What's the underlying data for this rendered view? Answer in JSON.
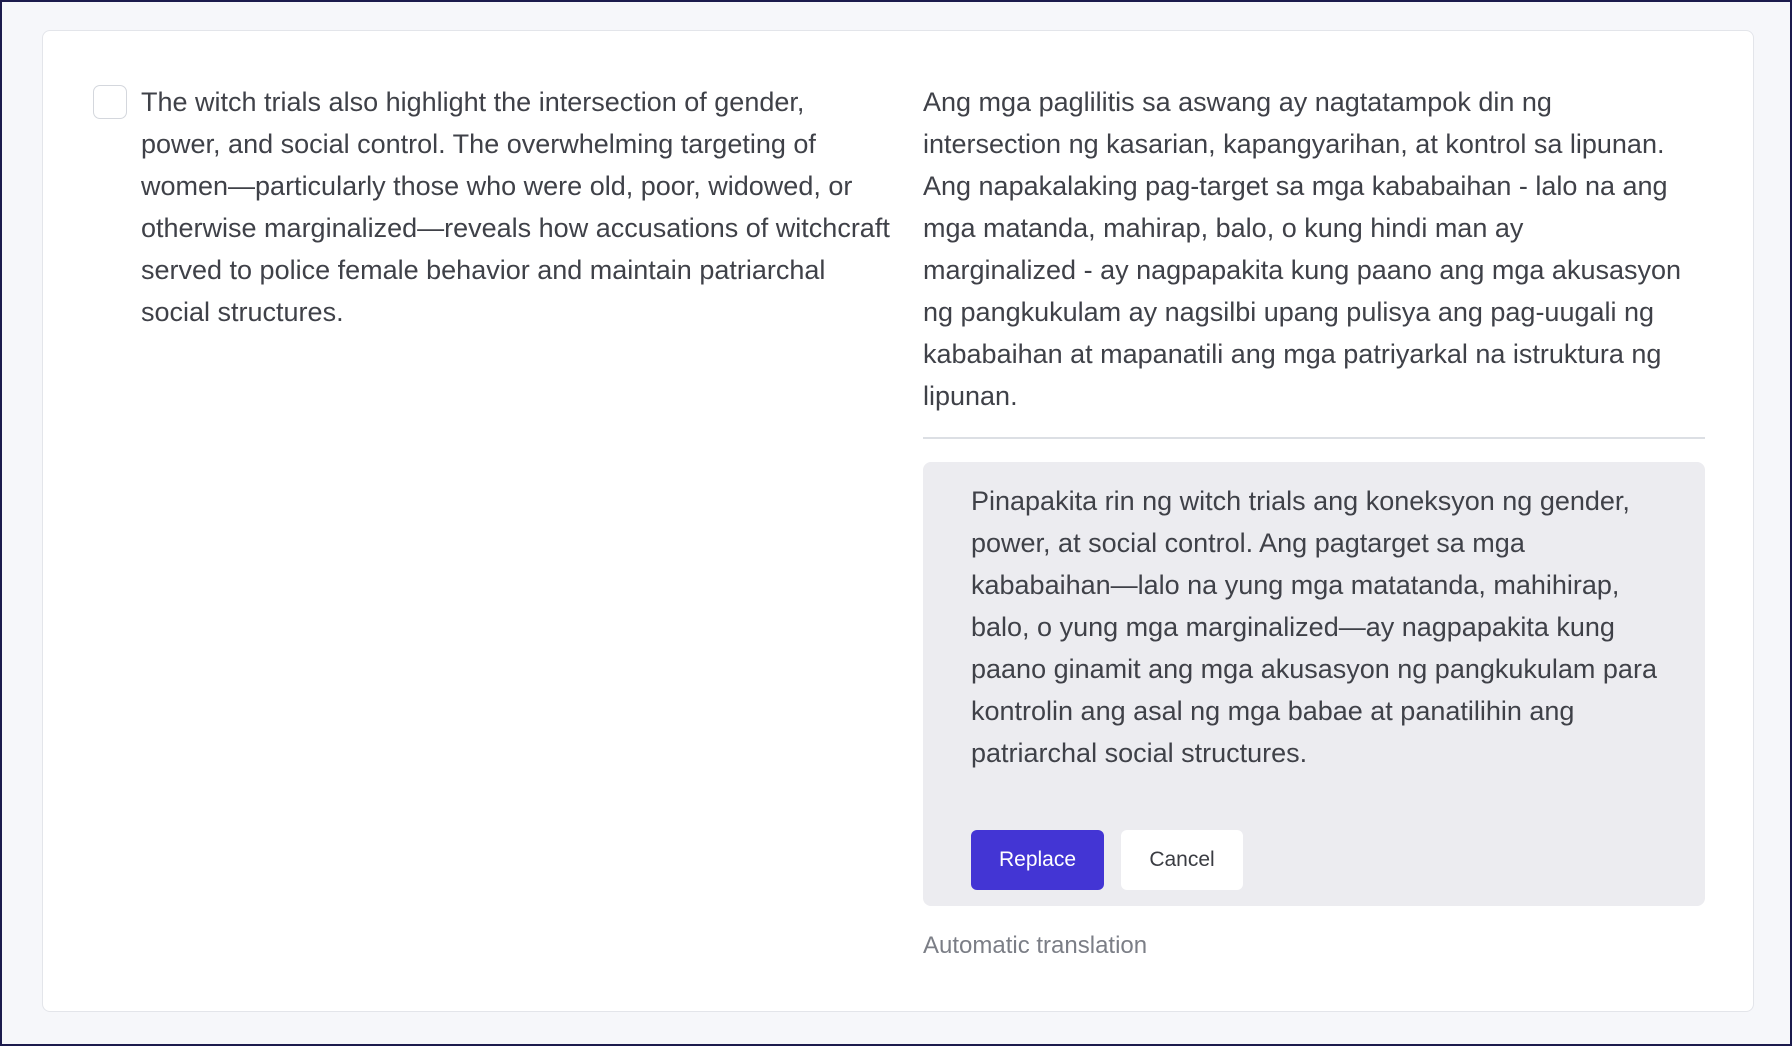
{
  "source": {
    "text": "The witch trials also highlight the intersection of gender, power, and social control. The overwhelming targeting of women—particularly those who were old, poor, widowed, or otherwise marginalized—reveals how accusations of witchcraft served to police female behavior and maintain patriarchal social structures."
  },
  "translation": {
    "text": "Ang mga paglilitis sa aswang ay nagtatampok din ng intersection ng kasarian, kapangyarihan, at kontrol sa lipunan. Ang napakalaking pag-target sa mga kababaihan - lalo na ang mga matanda, mahirap, balo, o kung hindi man ay marginalized - ay nagpapakita kung paano ang mga akusasyon ng pangkukulam ay nagsilbi upang pulisya ang pag-uugali ng kababaihan at mapanatili ang mga patriyarkal na istruktura ng lipunan."
  },
  "suggestion": {
    "text": "Pinapakita rin ng witch trials ang koneksyon ng gender, power, at social control. Ang pagtarget sa mga kababaihan—lalo na yung mga matatanda, mahihirap, balo, o yung mga marginalized—ay nagpapakita kung paano ginamit ang mga akusasyon ng pangkukulam para kontrolin ang asal ng mga babae at panatilihin ang patriarchal social structures.",
    "replace_label": "Replace",
    "cancel_label": "Cancel"
  },
  "footer": {
    "automatic_label": "Automatic translation"
  },
  "colors": {
    "accent": "#4335d4",
    "suggestion_bg": "#ececf0",
    "page_bg": "#f6f7fa"
  }
}
